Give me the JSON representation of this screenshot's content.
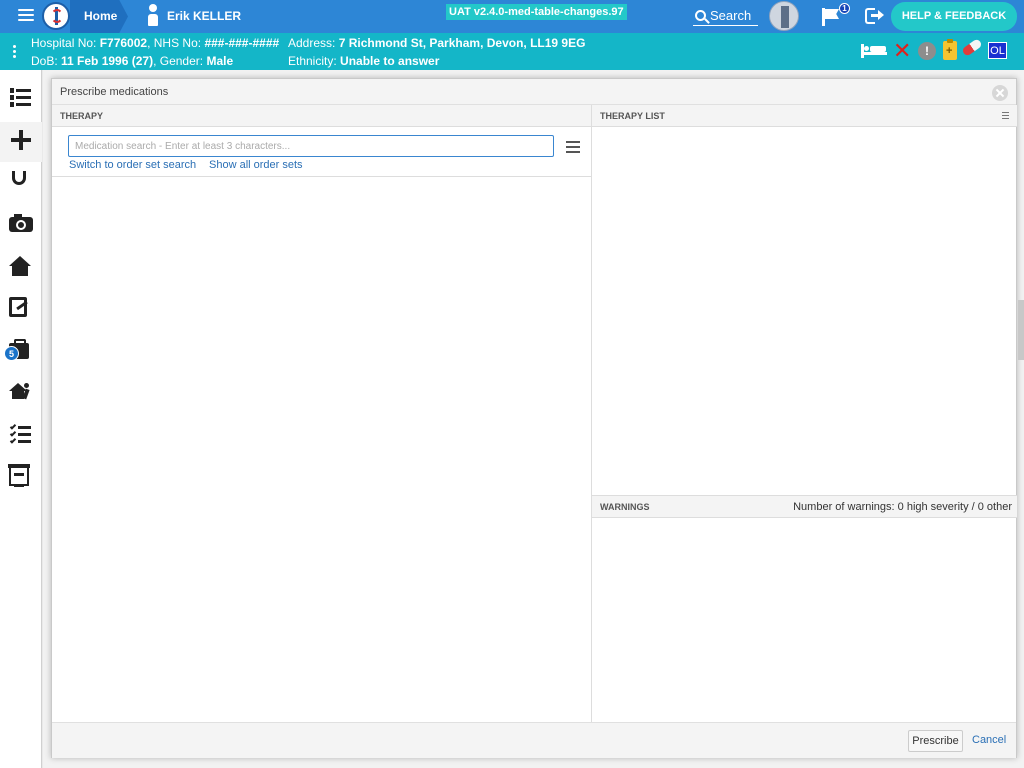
{
  "topbar": {
    "home_label": "Home",
    "user_name": "Erik KELLER",
    "version": "UAT v2.4.0-med-table-changes.97",
    "search_label": "Search",
    "notification_count": "1",
    "help_label": "HELP & FEEDBACK"
  },
  "patient": {
    "hospital_label": "Hospital No: ",
    "hospital_no": "F776002",
    "nhs_label": ", NHS No: ",
    "nhs_no": "###-###-####",
    "dob_label": "DoB: ",
    "dob": "11 Feb 1996 (27)",
    "gender_label": ", Gender: ",
    "gender": "Male",
    "address_label": "Address: ",
    "address": "7 Richmond St, Parkham, Devon, LL19 9EG",
    "ethnicity_label": "Ethnicity: ",
    "ethnicity": "Unable to answer",
    "status_icons": {
      "alert_glyph": "!",
      "ol_label": "OL",
      "x_color": "#e0201c",
      "ol_color": "#1a2fd1"
    }
  },
  "leftnav": {
    "icons": [
      "list-icon",
      "plus-icon",
      "stethoscope-icon",
      "camera-icon",
      "home-icon",
      "document-edit-icon",
      "briefcase-icon",
      "discharge-icon",
      "checklist-icon",
      "pharmacy-icon"
    ],
    "badge_count": "5"
  },
  "modal": {
    "title": "Prescribe medications",
    "therapy": {
      "header": "THERAPY",
      "search_placeholder": "Medication search - Enter at least 3 characters...",
      "search_value": "",
      "switch_link": "Switch to order set search",
      "show_all_link": "Show all order sets"
    },
    "therapy_list": {
      "header": "THERAPY LIST"
    },
    "warnings": {
      "header": "WARNINGS",
      "count_text": "Number of warnings: 0 high severity / 0 other"
    },
    "footer": {
      "prescribe_label": "Prescribe",
      "cancel_label": "Cancel"
    }
  },
  "colors": {
    "topbar": "#2d86d6",
    "patientbar": "#14b6c8",
    "accent_teal": "#23c8c9",
    "link": "#2a6fb5"
  }
}
